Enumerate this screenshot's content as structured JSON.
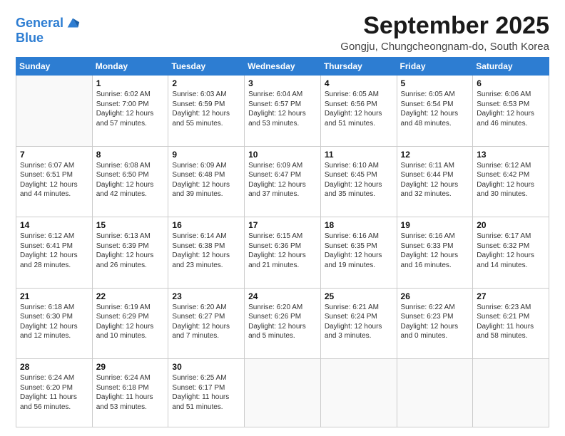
{
  "logo": {
    "line1": "General",
    "line2": "Blue"
  },
  "header": {
    "month": "September 2025",
    "location": "Gongju, Chungcheongnam-do, South Korea"
  },
  "weekdays": [
    "Sunday",
    "Monday",
    "Tuesday",
    "Wednesday",
    "Thursday",
    "Friday",
    "Saturday"
  ],
  "weeks": [
    [
      {
        "day": "",
        "info": ""
      },
      {
        "day": "1",
        "info": "Sunrise: 6:02 AM\nSunset: 7:00 PM\nDaylight: 12 hours\nand 57 minutes."
      },
      {
        "day": "2",
        "info": "Sunrise: 6:03 AM\nSunset: 6:59 PM\nDaylight: 12 hours\nand 55 minutes."
      },
      {
        "day": "3",
        "info": "Sunrise: 6:04 AM\nSunset: 6:57 PM\nDaylight: 12 hours\nand 53 minutes."
      },
      {
        "day": "4",
        "info": "Sunrise: 6:05 AM\nSunset: 6:56 PM\nDaylight: 12 hours\nand 51 minutes."
      },
      {
        "day": "5",
        "info": "Sunrise: 6:05 AM\nSunset: 6:54 PM\nDaylight: 12 hours\nand 48 minutes."
      },
      {
        "day": "6",
        "info": "Sunrise: 6:06 AM\nSunset: 6:53 PM\nDaylight: 12 hours\nand 46 minutes."
      }
    ],
    [
      {
        "day": "7",
        "info": "Sunrise: 6:07 AM\nSunset: 6:51 PM\nDaylight: 12 hours\nand 44 minutes."
      },
      {
        "day": "8",
        "info": "Sunrise: 6:08 AM\nSunset: 6:50 PM\nDaylight: 12 hours\nand 42 minutes."
      },
      {
        "day": "9",
        "info": "Sunrise: 6:09 AM\nSunset: 6:48 PM\nDaylight: 12 hours\nand 39 minutes."
      },
      {
        "day": "10",
        "info": "Sunrise: 6:09 AM\nSunset: 6:47 PM\nDaylight: 12 hours\nand 37 minutes."
      },
      {
        "day": "11",
        "info": "Sunrise: 6:10 AM\nSunset: 6:45 PM\nDaylight: 12 hours\nand 35 minutes."
      },
      {
        "day": "12",
        "info": "Sunrise: 6:11 AM\nSunset: 6:44 PM\nDaylight: 12 hours\nand 32 minutes."
      },
      {
        "day": "13",
        "info": "Sunrise: 6:12 AM\nSunset: 6:42 PM\nDaylight: 12 hours\nand 30 minutes."
      }
    ],
    [
      {
        "day": "14",
        "info": "Sunrise: 6:12 AM\nSunset: 6:41 PM\nDaylight: 12 hours\nand 28 minutes."
      },
      {
        "day": "15",
        "info": "Sunrise: 6:13 AM\nSunset: 6:39 PM\nDaylight: 12 hours\nand 26 minutes."
      },
      {
        "day": "16",
        "info": "Sunrise: 6:14 AM\nSunset: 6:38 PM\nDaylight: 12 hours\nand 23 minutes."
      },
      {
        "day": "17",
        "info": "Sunrise: 6:15 AM\nSunset: 6:36 PM\nDaylight: 12 hours\nand 21 minutes."
      },
      {
        "day": "18",
        "info": "Sunrise: 6:16 AM\nSunset: 6:35 PM\nDaylight: 12 hours\nand 19 minutes."
      },
      {
        "day": "19",
        "info": "Sunrise: 6:16 AM\nSunset: 6:33 PM\nDaylight: 12 hours\nand 16 minutes."
      },
      {
        "day": "20",
        "info": "Sunrise: 6:17 AM\nSunset: 6:32 PM\nDaylight: 12 hours\nand 14 minutes."
      }
    ],
    [
      {
        "day": "21",
        "info": "Sunrise: 6:18 AM\nSunset: 6:30 PM\nDaylight: 12 hours\nand 12 minutes."
      },
      {
        "day": "22",
        "info": "Sunrise: 6:19 AM\nSunset: 6:29 PM\nDaylight: 12 hours\nand 10 minutes."
      },
      {
        "day": "23",
        "info": "Sunrise: 6:20 AM\nSunset: 6:27 PM\nDaylight: 12 hours\nand 7 minutes."
      },
      {
        "day": "24",
        "info": "Sunrise: 6:20 AM\nSunset: 6:26 PM\nDaylight: 12 hours\nand 5 minutes."
      },
      {
        "day": "25",
        "info": "Sunrise: 6:21 AM\nSunset: 6:24 PM\nDaylight: 12 hours\nand 3 minutes."
      },
      {
        "day": "26",
        "info": "Sunrise: 6:22 AM\nSunset: 6:23 PM\nDaylight: 12 hours\nand 0 minutes."
      },
      {
        "day": "27",
        "info": "Sunrise: 6:23 AM\nSunset: 6:21 PM\nDaylight: 11 hours\nand 58 minutes."
      }
    ],
    [
      {
        "day": "28",
        "info": "Sunrise: 6:24 AM\nSunset: 6:20 PM\nDaylight: 11 hours\nand 56 minutes."
      },
      {
        "day": "29",
        "info": "Sunrise: 6:24 AM\nSunset: 6:18 PM\nDaylight: 11 hours\nand 53 minutes."
      },
      {
        "day": "30",
        "info": "Sunrise: 6:25 AM\nSunset: 6:17 PM\nDaylight: 11 hours\nand 51 minutes."
      },
      {
        "day": "",
        "info": ""
      },
      {
        "day": "",
        "info": ""
      },
      {
        "day": "",
        "info": ""
      },
      {
        "day": "",
        "info": ""
      }
    ]
  ]
}
